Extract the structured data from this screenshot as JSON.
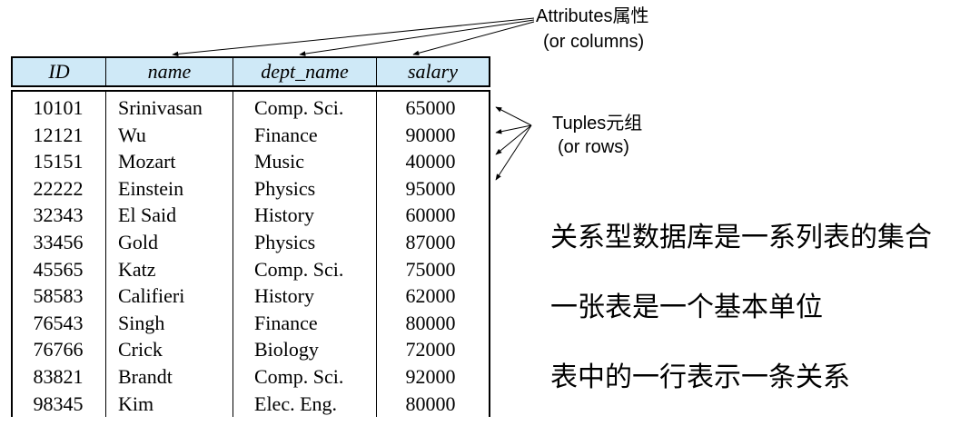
{
  "columns": [
    "ID",
    "name",
    "dept_name",
    "salary"
  ],
  "rows": [
    [
      "10101",
      "Srinivasan",
      "Comp. Sci.",
      "65000"
    ],
    [
      "12121",
      "Wu",
      "Finance",
      "90000"
    ],
    [
      "15151",
      "Mozart",
      "Music",
      "40000"
    ],
    [
      "22222",
      "Einstein",
      "Physics",
      "95000"
    ],
    [
      "32343",
      "El Said",
      "History",
      "60000"
    ],
    [
      "33456",
      "Gold",
      "Physics",
      "87000"
    ],
    [
      "45565",
      "Katz",
      "Comp. Sci.",
      "75000"
    ],
    [
      "58583",
      "Califieri",
      "History",
      "62000"
    ],
    [
      "76543",
      "Singh",
      "Finance",
      "80000"
    ],
    [
      "76766",
      "Crick",
      "Biology",
      "72000"
    ],
    [
      "83821",
      "Brandt",
      "Comp. Sci.",
      "92000"
    ],
    [
      "98345",
      "Kim",
      "Elec. Eng.",
      "80000"
    ]
  ],
  "annotations": {
    "attributes_line1": "Attributes属性",
    "attributes_line2": "(or columns)",
    "tuples_line1": "Tuples元组",
    "tuples_line2": "(or rows)"
  },
  "notes": [
    "关系型数据库是一系列表的集合",
    "一张表是一个基本单位",
    "表中的一行表示一条关系"
  ],
  "colors": {
    "header_bg": "#cfe9f7",
    "line": "#000000"
  }
}
